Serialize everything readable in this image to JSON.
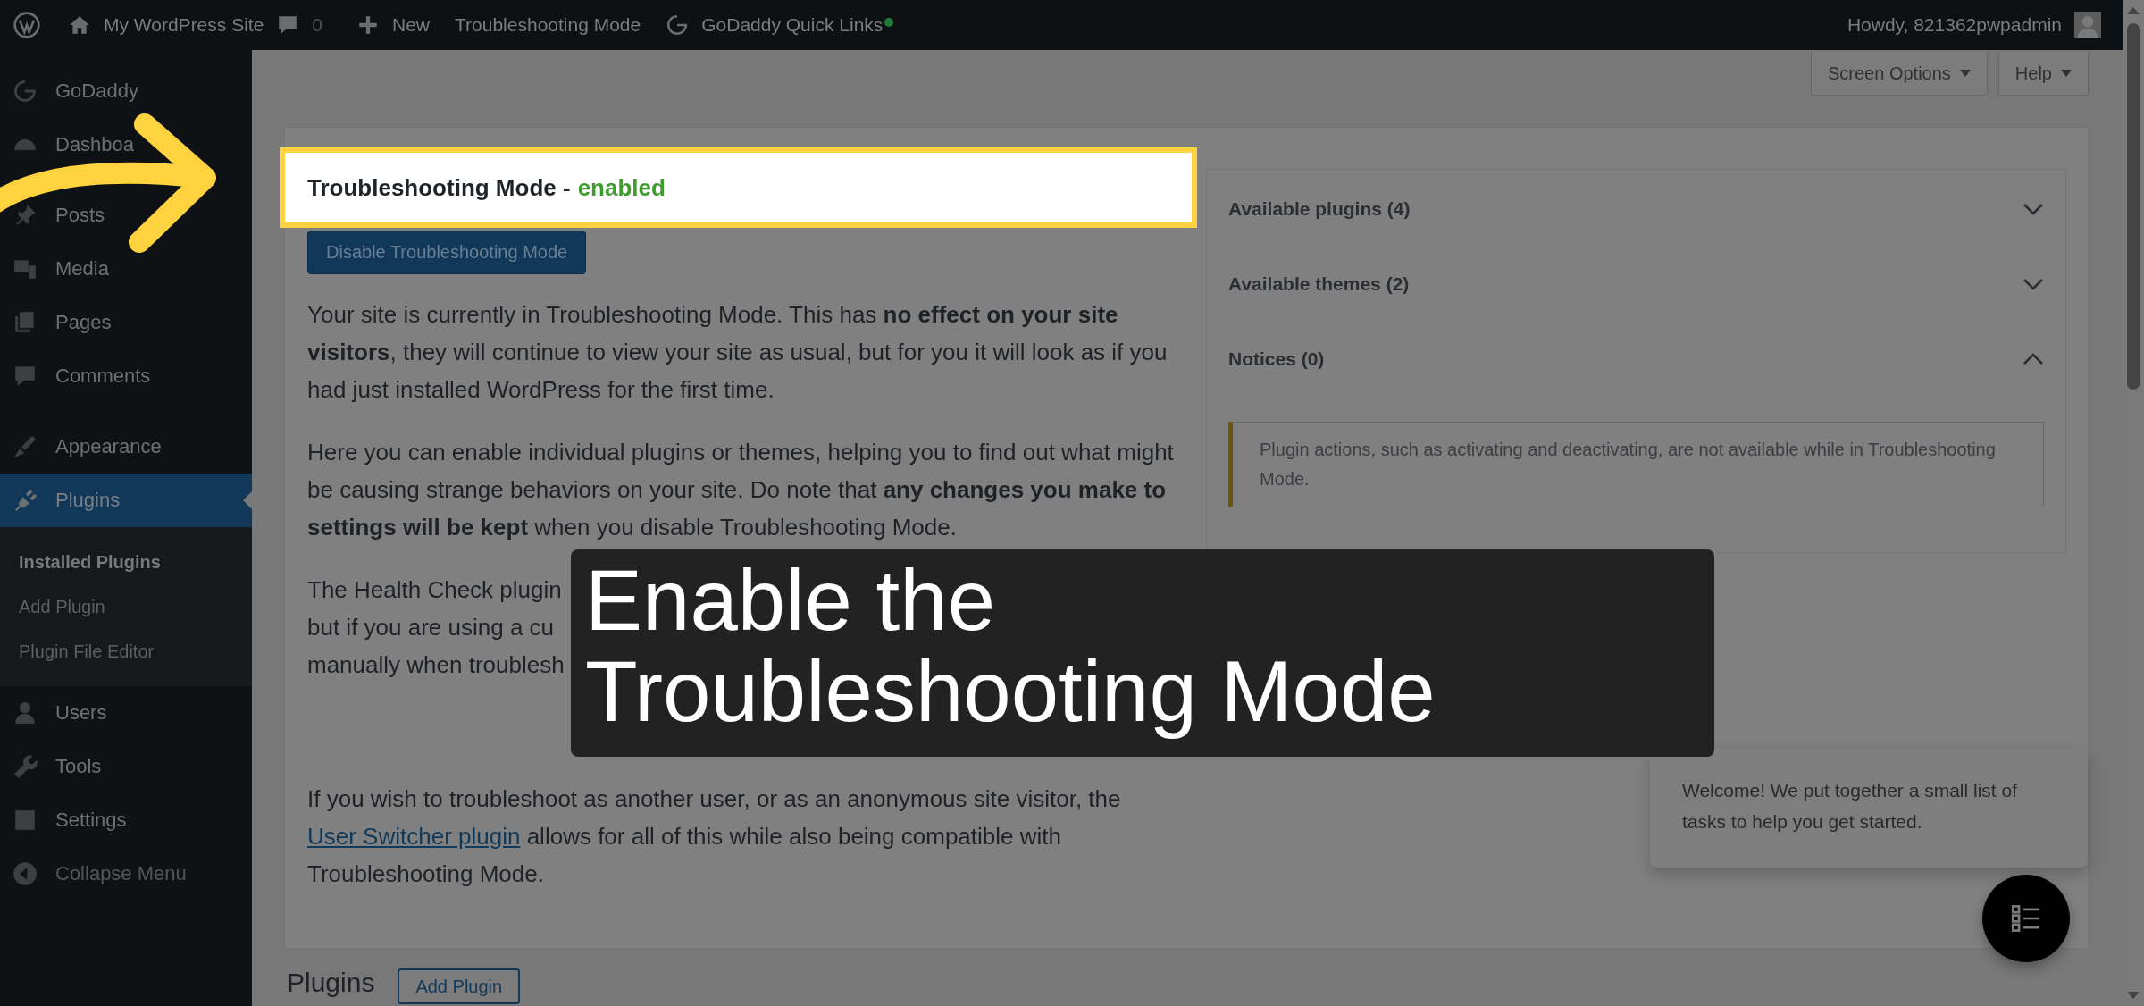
{
  "admin_bar": {
    "site_name": "My WordPress Site",
    "comments_count": "0",
    "new_label": "New",
    "troubleshooting_label": "Troubleshooting Mode",
    "quick_links_label": "GoDaddy Quick Links",
    "quick_links_notification": true,
    "greeting": "Howdy, 821362pwpadmin"
  },
  "sidebar": {
    "groups": [
      [
        {
          "label": "GoDaddy",
          "selected": false
        },
        {
          "label": "Dashboa",
          "selected": false
        }
      ],
      [
        {
          "label": "Posts",
          "selected": false
        },
        {
          "label": "Media",
          "selected": false
        },
        {
          "label": "Pages",
          "selected": false
        },
        {
          "label": "Comments",
          "selected": false
        }
      ],
      [
        {
          "label": "Appearance",
          "selected": false
        },
        {
          "label": "Plugins",
          "selected": true,
          "children": [
            {
              "label": "Installed Plugins",
              "selected": true
            },
            {
              "label": "Add Plugin",
              "selected": false
            },
            {
              "label": "Plugin File Editor",
              "selected": false
            }
          ]
        },
        {
          "label": "Users",
          "selected": false
        },
        {
          "label": "Tools",
          "selected": false
        },
        {
          "label": "Settings",
          "selected": false
        }
      ]
    ],
    "collapse_label": "Collapse Menu"
  },
  "top_buttons": [
    {
      "label": "Screen Options"
    },
    {
      "label": "Help"
    }
  ],
  "status": {
    "heading": "Troubleshooting Mode -",
    "state": "enabled"
  },
  "disable_button": "Disable Troubleshooting Mode",
  "paragraphs": [
    {
      "kind": "text",
      "text": "Your site is currently in Troubleshooting Mode. This has **no effect on your site visitors**, they will continue to view your site as usual, but for you it will look as if you had just installed WordPress for the first time."
    },
    {
      "kind": "text",
      "text": "Here you can enable individual plugins or themes, helping you to find out what might be causing strange behaviors on your site. Do note that **any changes you make to settings will be kept** when you disable Troubleshooting Mode."
    },
    {
      "kind": "fragments",
      "lines": [
        "The Health Check plugin",
        "but if you are using a cu",
        "manually when troublesh"
      ]
    },
    {
      "kind": "link",
      "before": "If you wish to troubleshoot as another user, or as an anonymous site visitor, the ",
      "link": "User Switcher plugin",
      "after": " allows for all of this while also being compatible with Troubleshooting Mode."
    }
  ],
  "accordion": [
    {
      "label": "Available plugins (4)",
      "expanded": false
    },
    {
      "label": "Available themes (2)",
      "expanded": false
    },
    {
      "label": "Notices (0)",
      "expanded": true,
      "notice": "Plugin actions, such as activating and deactivating, are not available while in Troubleshooting Mode."
    }
  ],
  "caption": "Enable the Troubleshooting Mode",
  "welcome": "Welcome! We put together a small list of tasks to help you get started.",
  "plugins_section": {
    "heading": "Plugins",
    "add_button": "Add Plugin"
  }
}
